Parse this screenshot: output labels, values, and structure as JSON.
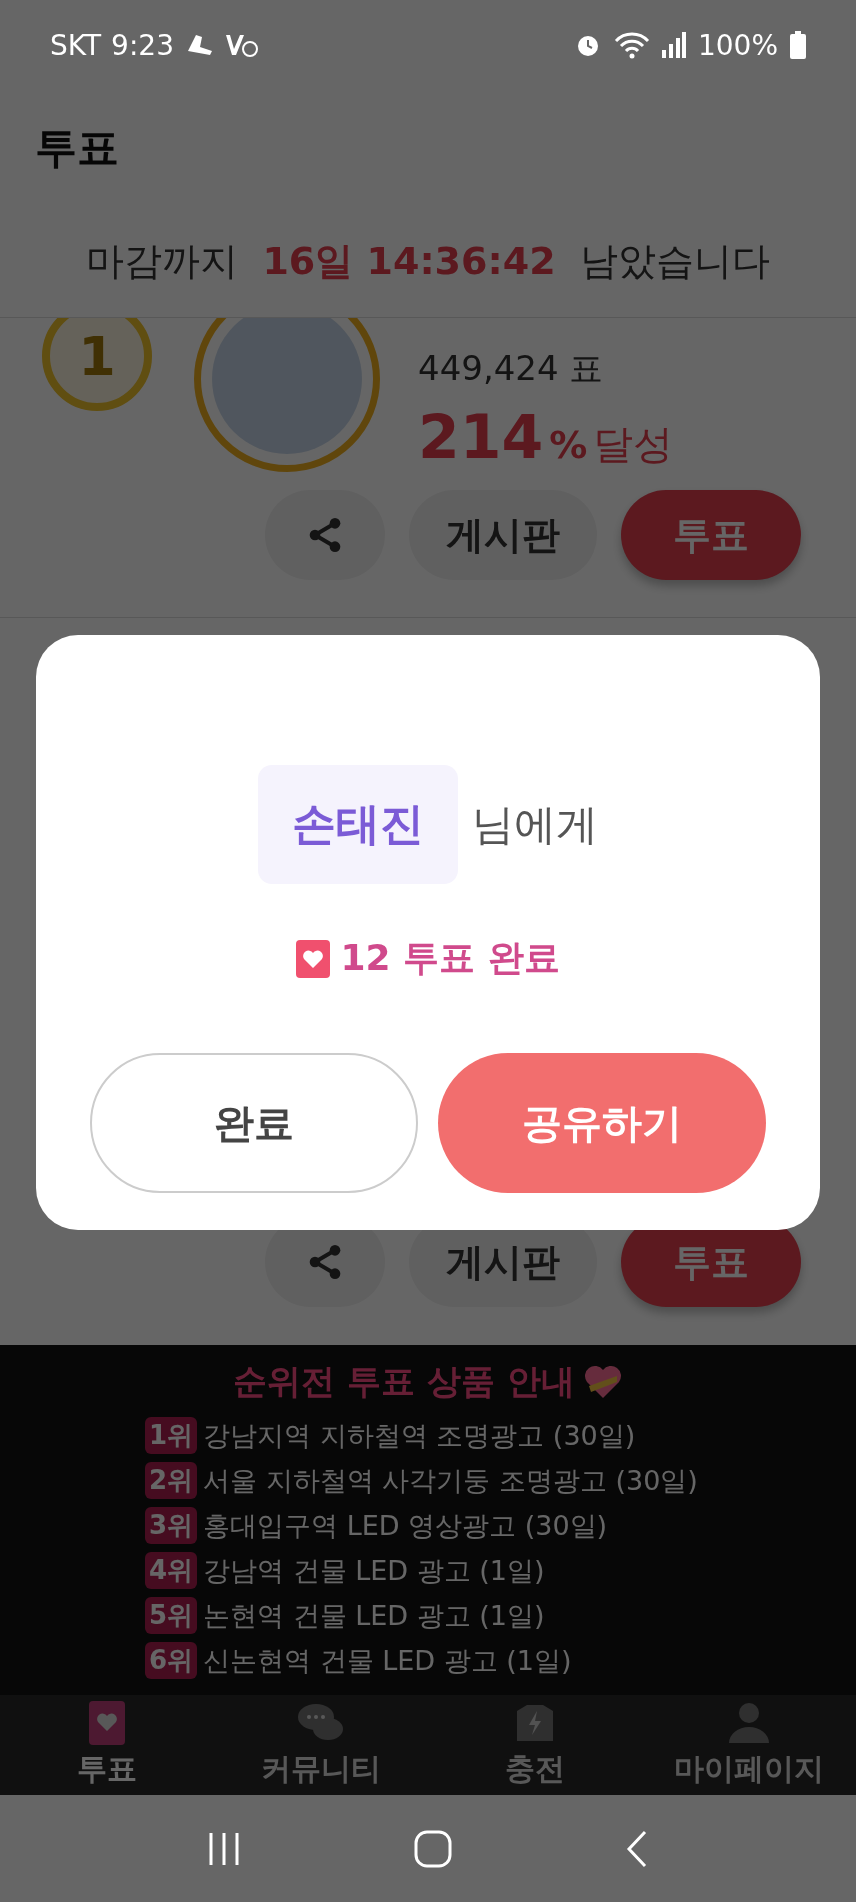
{
  "status_bar": {
    "carrier": "SKT",
    "time": "9:23",
    "battery": "100%"
  },
  "header": {
    "title": "투표"
  },
  "countdown": {
    "prefix": "마감까지",
    "time": "16일 14:36:42",
    "suffix": "남았습니다"
  },
  "candidates": [
    {
      "rank": "1",
      "votes": "449,424 표",
      "percent": "214",
      "percent_unit": "%",
      "achieved": "달성",
      "board": "게시판",
      "vote": "투표"
    },
    {
      "board": "게시판",
      "vote": "투표"
    }
  ],
  "prize_banner": {
    "title": "순위전 투표 상품 안내",
    "items": [
      {
        "rank": "1위",
        "text": "강남지역 지하철역 조명광고 (30일)"
      },
      {
        "rank": "2위",
        "text": "서울 지하철역 사각기둥 조명광고 (30일)"
      },
      {
        "rank": "3위",
        "text": "홍대입구역 LED 영상광고 (30일)"
      },
      {
        "rank": "4위",
        "text": "강남역 건물 LED 광고 (1일)"
      },
      {
        "rank": "5위",
        "text": "논현역 건물 LED 광고 (1일)"
      },
      {
        "rank": "6위",
        "text": "신논현역 건물 LED 광고 (1일)"
      }
    ]
  },
  "bottom_nav": [
    {
      "label": "투표",
      "selected": true
    },
    {
      "label": "커뮤니티",
      "selected": false
    },
    {
      "label": "충전",
      "selected": false
    },
    {
      "label": "마이페이지",
      "selected": false
    }
  ],
  "dialog": {
    "name": "손태진",
    "suffix": "님에게",
    "result": "12 투표 완료",
    "buttons": [
      {
        "label": "완료",
        "kind": "secondary"
      },
      {
        "label": "공유하기",
        "kind": "primary"
      }
    ]
  }
}
